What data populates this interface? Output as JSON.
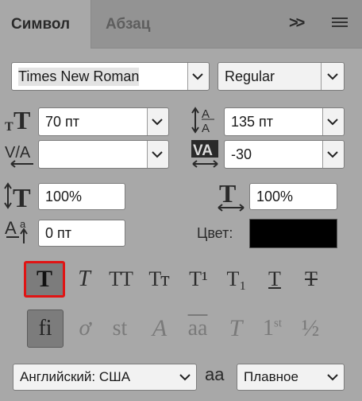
{
  "tabs": [
    {
      "label": "Символ",
      "active": true
    },
    {
      "label": "Абзац",
      "active": false
    }
  ],
  "header": {
    "expand_glyph": ">>",
    "menu_icon": "hamburger-menu-icon"
  },
  "font": {
    "family": "Times New Roman",
    "style": "Regular"
  },
  "size": {
    "value": "70 пт",
    "icon": "font-size-icon"
  },
  "leading": {
    "value": "135 пт",
    "icon": "leading-icon"
  },
  "kerning": {
    "value": "",
    "icon": "kerning-icon"
  },
  "tracking": {
    "value": "-30",
    "icon": "tracking-icon"
  },
  "vscale": {
    "value": "100%",
    "icon": "vertical-scale-icon"
  },
  "hscale": {
    "value": "100%",
    "icon": "horizontal-scale-icon"
  },
  "baseline": {
    "value": "0 пт",
    "icon": "baseline-shift-icon"
  },
  "color": {
    "label": "Цвет:",
    "value": "#000000"
  },
  "style_buttons": {
    "faux_bold": "T",
    "faux_italic": "T",
    "all_caps": "TT",
    "small_caps": "Tт",
    "superscript": "T¹",
    "subscript": "T₁",
    "underline": "T",
    "strikethrough": "T",
    "selected": "faux_bold"
  },
  "opentype_buttons": {
    "standard_ligatures": "fi",
    "contextual_alternates": "ơ",
    "discretionary_ligatures": "st",
    "swash": "A",
    "stylistic_alternates": "aa",
    "titling": "T",
    "ordinals_base": "1",
    "ordinals_sup": "st",
    "fractions": "½",
    "selected": "standard_ligatures"
  },
  "language": {
    "value": "Английский: США"
  },
  "antialias": {
    "icon_text": "aa",
    "value": "Плавное"
  },
  "colors": {
    "panel": "#a8a8a8",
    "tabbar": "#939393",
    "selection_outline": "#e01414"
  }
}
